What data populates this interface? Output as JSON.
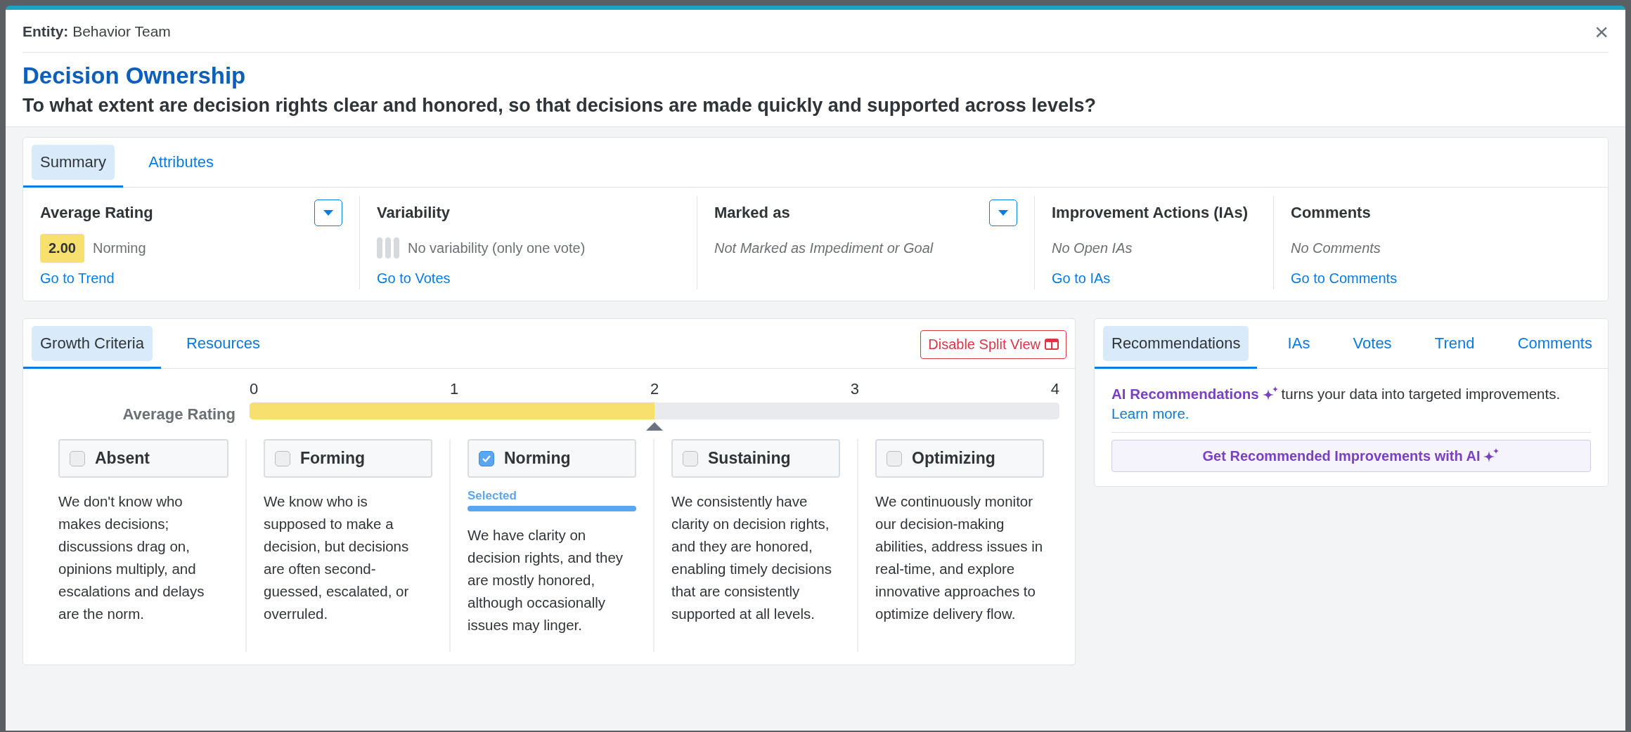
{
  "modal": {
    "entity_label": "Entity:",
    "entity": "Behavior Team",
    "title": "Decision Ownership",
    "question": "To what extent are decision rights clear and honored, so that decisions are made quickly and supported across levels?",
    "close": "×"
  },
  "summary": {
    "tabs": [
      {
        "label": "Summary",
        "selected": true
      },
      {
        "label": "Attributes",
        "selected": false
      }
    ],
    "columns": [
      {
        "kind": "rating",
        "title": "Average Rating",
        "dropdown": true,
        "score": "2.00",
        "value": "Norming",
        "link": "Go to Trend"
      },
      {
        "kind": "variability",
        "title": "Variability",
        "value": "No variability (only one vote)",
        "link": "Go to Votes"
      },
      {
        "kind": "note",
        "title": "Marked as",
        "dropdown": true,
        "value": "Not Marked as Impediment or Goal"
      },
      {
        "kind": "note",
        "title": "Improvement Actions (IAs)",
        "value": "No Open IAs",
        "link": "Go to IAs"
      },
      {
        "kind": "note",
        "title": "Comments",
        "value": "No Comments",
        "link": "Go to Comments"
      }
    ]
  },
  "growth": {
    "tabs": [
      {
        "label": "Growth Criteria",
        "selected": true
      },
      {
        "label": "Resources",
        "selected": false
      }
    ],
    "split_button": "Disable Split View",
    "rating": {
      "label": "Average Rating",
      "ticks": [
        "0",
        "1",
        "2",
        "3",
        "4"
      ],
      "level": 0.5
    },
    "criteria": [
      {
        "label": "Absent",
        "checked": false,
        "description": "We don't know who makes decisions; discussions drag on, opinions multiply, and escalations and delays are the norm."
      },
      {
        "label": "Forming",
        "checked": false,
        "description": "We know who is supposed to make a decision, but decisions are often second-guessed, escalated, or overruled."
      },
      {
        "label": "Norming",
        "checked": true,
        "badge": "Selected",
        "description": "We have clarity on decision rights, and they are mostly honored, although occasionally issues may linger."
      },
      {
        "label": "Sustaining",
        "checked": false,
        "description": "We consistently have clarity on decision rights, and they are honored, enabling timely decisions that are consistently supported at all levels."
      },
      {
        "label": "Optimizing",
        "checked": false,
        "description": "We continuously monitor our decision-making abilities, address issues in real-time, and explore innovative approaches to optimize delivery flow."
      }
    ]
  },
  "side": {
    "tabs": [
      {
        "label": "Recommendations",
        "selected": true
      },
      {
        "label": "IAs",
        "selected": false
      },
      {
        "label": "Votes",
        "selected": false
      },
      {
        "label": "Trend",
        "selected": false
      },
      {
        "label": "Comments",
        "selected": false
      }
    ],
    "ai_name": "AI Recommendations",
    "ai_text": "turns your data into targeted improvements.",
    "learn_more": "Learn more.",
    "ai_button": "Get Recommended Improvements with AI"
  }
}
